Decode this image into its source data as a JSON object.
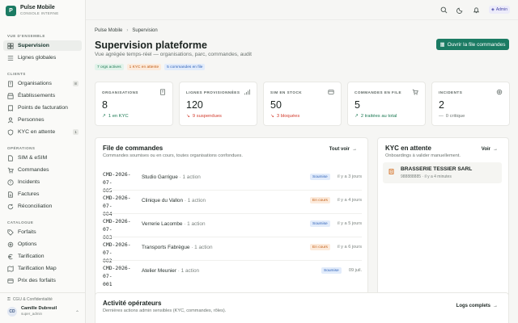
{
  "brand": {
    "logo_letter": "P",
    "name": "Pulse Mobile",
    "subtitle": "CONSOLE INTERNE"
  },
  "sidebar": {
    "sections": [
      {
        "label": "VUE D'ENSEMBLE"
      },
      {
        "label": "CLIENTS"
      },
      {
        "label": "OPÉRATIONS"
      },
      {
        "label": "CATALOGUE"
      }
    ],
    "items": [
      {
        "label": "Supervision",
        "icon": "grid-icon",
        "active": true
      },
      {
        "label": "Lignes globales",
        "icon": "list-icon"
      },
      {
        "label": "Organisations",
        "icon": "building-icon",
        "badge": "8"
      },
      {
        "label": "Établissements",
        "icon": "store-icon"
      },
      {
        "label": "Points de facturation",
        "icon": "receipt-icon"
      },
      {
        "label": "Personnes",
        "icon": "person-icon"
      },
      {
        "label": "KYC en attente",
        "icon": "shield-icon",
        "badge": "1"
      },
      {
        "label": "SIM & eSIM",
        "icon": "sim-icon"
      },
      {
        "label": "Commandes",
        "icon": "cart-icon"
      },
      {
        "label": "Incidents",
        "icon": "alert-icon"
      },
      {
        "label": "Factures",
        "icon": "document-icon"
      },
      {
        "label": "Réconciliation",
        "icon": "refresh-icon"
      },
      {
        "label": "Forfaits",
        "icon": "tag-icon"
      },
      {
        "label": "Options",
        "icon": "sliders-icon"
      },
      {
        "label": "Tarification",
        "icon": "euro-icon"
      },
      {
        "label": "Tarification Map",
        "icon": "map-icon"
      },
      {
        "label": "Prix des forfaits",
        "icon": "price-icon"
      }
    ],
    "footer": {
      "cgu_label": "CGU & Confidentialité",
      "user_initials": "CD",
      "user_name": "Camille Dubreuil",
      "user_role": "super_admin"
    }
  },
  "topbar": {
    "admin_label": "Admin"
  },
  "main": {
    "breadcrumb": [
      "Pulse Mobile",
      "Supervision"
    ],
    "title": "Supervision plateforme",
    "subtitle": "Vue agrégée temps-réel — organisations, parc, commandes, audit",
    "chips": [
      {
        "label": "7 orgs actives",
        "tone": "green"
      },
      {
        "label": "1 KYC en attente",
        "tone": "orange"
      },
      {
        "label": "5 commandes en file",
        "tone": "blue"
      }
    ],
    "primary_button": "Ouvrir la file commandes"
  },
  "stats": [
    {
      "label": "ORGANISATIONS",
      "value": "8",
      "delta": "1 en KYC",
      "trend": "up",
      "icon": "building-icon"
    },
    {
      "label": "LIGNES PROVISIONNÉES",
      "value": "120",
      "delta": "9 suspendues",
      "trend": "down",
      "icon": "signal-icon"
    },
    {
      "label": "SIM EN STOCK",
      "value": "50",
      "delta": "3 bloquées",
      "trend": "down",
      "icon": "sim-icon"
    },
    {
      "label": "COMMANDES EN FILE",
      "value": "5",
      "delta": "2 traitées au total",
      "trend": "up",
      "icon": "cart-icon"
    },
    {
      "label": "INCIDENTS",
      "value": "2",
      "delta": "0 critique",
      "trend": "flat",
      "icon": "gear-icon"
    }
  ],
  "orders": {
    "title": "File de commandes",
    "subtitle": "Commandes soumises ou en cours, toutes organisations confondues.",
    "button": "Tout voir",
    "rows": [
      {
        "id_line1": "CMD-2026-07-",
        "id_line2": "005",
        "org": "Studio Garrigue",
        "action": "· 1 action",
        "status": "Soumise",
        "tone": "blue",
        "time": "il y a 3 jours"
      },
      {
        "id_line1": "CMD-2026-07-",
        "id_line2": "004",
        "org": "Clinique du Vallon",
        "action": "· 1 action",
        "status": "En cours",
        "tone": "orange",
        "time": "il y a 4 jours"
      },
      {
        "id_line1": "CMD-2026-07-",
        "id_line2": "003",
        "org": "Verrerie Lacombe",
        "action": "· 1 action",
        "status": "Soumise",
        "tone": "blue",
        "time": "il y a 5 jours"
      },
      {
        "id_line1": "CMD-2026-07-",
        "id_line2": "002",
        "org": "Transports Fabrègue",
        "action": "· 1 action",
        "status": "En cours",
        "tone": "orange",
        "time": "il y a 6 jours"
      },
      {
        "id_line1": "CMD-2026-07-",
        "id_line2": "001",
        "org": "Atelier Meunier",
        "action": "· 1 action",
        "status": "Soumise",
        "tone": "blue",
        "time": "09 juil."
      }
    ]
  },
  "kyc": {
    "title": "KYC en attente",
    "subtitle": "Onboardings à valider manuellement.",
    "button": "Voir",
    "item": {
      "name": "BRASSERIE TESSIER SARL",
      "meta": "988888885 · il y a 4 minutes"
    }
  },
  "activity": {
    "title": "Activité opérateurs",
    "subtitle": "Dernières actions admin sensibles (KYC, commandes, rôles).",
    "button": "Logs complets"
  },
  "colors": {
    "accent": "#1b7b63",
    "danger": "#d23b2c",
    "warning": "#c15b12",
    "info": "#2f62b8"
  }
}
